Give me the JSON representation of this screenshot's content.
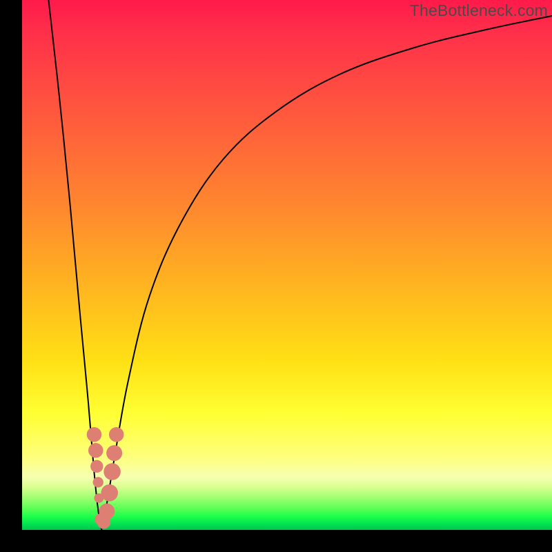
{
  "watermark": "TheBottleneck.com",
  "colors": {
    "frame": "#000000",
    "gradient_top": "#ff1a4a",
    "gradient_mid": "#ffff33",
    "gradient_bottom": "#00c44a",
    "curve": "#000000",
    "marker": "#de7f74"
  },
  "chart_data": {
    "type": "line",
    "title": "",
    "xlabel": "",
    "ylabel": "",
    "xlim": [
      0,
      100
    ],
    "ylim": [
      0,
      100
    ],
    "grid": false,
    "annotations": [
      "TheBottleneck.com"
    ],
    "series": [
      {
        "name": "left-branch",
        "x": [
          5,
          7,
          9,
          11,
          12.5,
          13.5,
          14.2,
          14.7,
          15.0
        ],
        "y": [
          100,
          82,
          62,
          40,
          24,
          12,
          5,
          1.5,
          0
        ]
      },
      {
        "name": "right-branch",
        "x": [
          15.0,
          16.0,
          17.5,
          20,
          24,
          30,
          38,
          48,
          60,
          74,
          88,
          100
        ],
        "y": [
          0,
          5,
          14,
          28,
          44,
          58,
          70,
          79,
          86,
          91,
          94.5,
          97
        ]
      }
    ],
    "markers": [
      {
        "x": 13.6,
        "y": 18,
        "r": 1.4
      },
      {
        "x": 13.9,
        "y": 15,
        "r": 1.4
      },
      {
        "x": 14.1,
        "y": 12,
        "r": 1.2
      },
      {
        "x": 14.35,
        "y": 9,
        "r": 1.0
      },
      {
        "x": 14.5,
        "y": 6,
        "r": 0.9
      },
      {
        "x": 14.8,
        "y": 2,
        "r": 1.1
      },
      {
        "x": 15.4,
        "y": 1.5,
        "r": 1.3
      },
      {
        "x": 16.0,
        "y": 3.5,
        "r": 1.5
      },
      {
        "x": 16.5,
        "y": 7,
        "r": 1.6
      },
      {
        "x": 17.0,
        "y": 11,
        "r": 1.6
      },
      {
        "x": 17.4,
        "y": 14.5,
        "r": 1.5
      },
      {
        "x": 17.8,
        "y": 18,
        "r": 1.4
      }
    ],
    "minimum_x": 15.0
  }
}
